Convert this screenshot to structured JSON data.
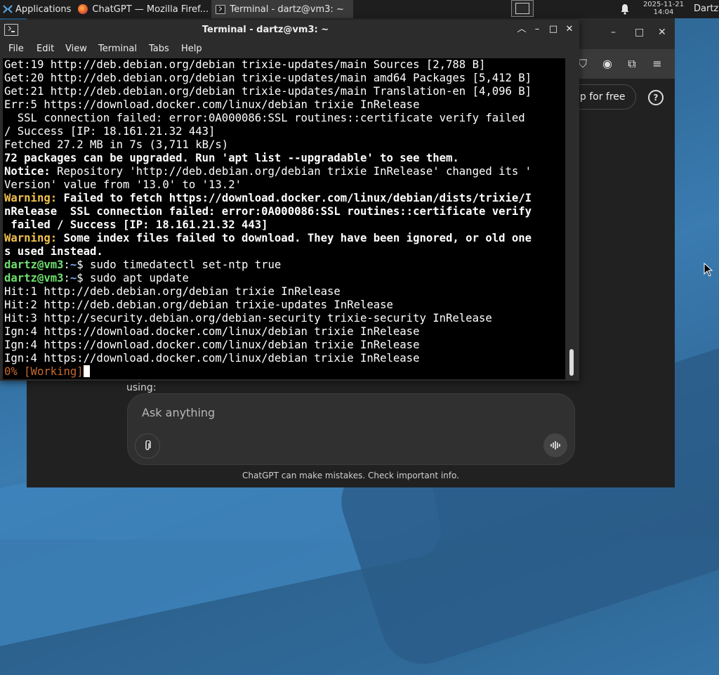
{
  "panel": {
    "apps_label": "Applications",
    "tasks": [
      {
        "label": "ChatGPT — Mozilla Firef..."
      },
      {
        "label": "Terminal - dartz@vm3: ~"
      }
    ],
    "clock_date": "2025-11-21",
    "clock_time": "14:04",
    "user": "Dartz"
  },
  "firefox": {
    "signup_label": "up for free",
    "help_label": "?",
    "partial_text": "using:",
    "composer_placeholder": "Ask anything",
    "disclaimer": "ChatGPT can make mistakes. Check important info."
  },
  "terminal": {
    "title": "Terminal - dartz@vm3: ~",
    "menu": [
      "File",
      "Edit",
      "View",
      "Terminal",
      "Tabs",
      "Help"
    ],
    "lines": [
      [
        {
          "t": "Get:19 http://deb.debian.org/debian trixie-updates/main Sources [2,788 B]"
        }
      ],
      [
        {
          "t": "Get:20 http://deb.debian.org/debian trixie-updates/main amd64 Packages [5,412 B]"
        }
      ],
      [
        {
          "t": "Get:21 http://deb.debian.org/debian trixie-updates/main Translation-en [4,096 B]"
        }
      ],
      [
        {
          "t": "Err:5 https://download.docker.com/linux/debian trixie InRelease"
        }
      ],
      [
        {
          "t": "  SSL connection failed: error:0A000086:SSL routines::certificate verify failed"
        }
      ],
      [
        {
          "t": "/ Success [IP: 18.161.21.32 443]"
        }
      ],
      [
        {
          "t": "Fetched 27.2 MB in 7s (3,711 kB/s)"
        }
      ],
      [
        {
          "t": "72 packages can be upgraded. Run 'apt list --upgradable' to see them.",
          "c": "bold"
        }
      ],
      [
        {
          "t": "Notice:",
          "c": "bold"
        },
        {
          "t": " Repository 'http://deb.debian.org/debian trixie InRelease' changed its '"
        }
      ],
      [
        {
          "t": "Version' value from '13.0' to '13.2'"
        }
      ],
      [
        {
          "t": "Warning:",
          "c": "yellow"
        },
        {
          "t": " Failed to fetch https://download.docker.com/linux/debian/dists/trixie/I",
          "c": "bold"
        }
      ],
      [
        {
          "t": "nRelease  SSL connection failed: error:0A000086:SSL routines::certificate verify",
          "c": "bold"
        }
      ],
      [
        {
          "t": " failed / Success [IP: 18.161.21.32 443]",
          "c": "bold"
        }
      ],
      [
        {
          "t": "Warning:",
          "c": "yellow"
        },
        {
          "t": " Some index files failed to download. They have been ignored, or old one",
          "c": "bold"
        }
      ],
      [
        {
          "t": "s used instead.",
          "c": "bold"
        }
      ],
      [
        {
          "t": "dartz@vm3",
          "c": "green"
        },
        {
          "t": ":"
        },
        {
          "t": "~",
          "c": "blue"
        },
        {
          "t": "$ sudo timedatectl set-ntp true"
        }
      ],
      [
        {
          "t": "dartz@vm3",
          "c": "green"
        },
        {
          "t": ":"
        },
        {
          "t": "~",
          "c": "blue"
        },
        {
          "t": "$ sudo apt update"
        }
      ],
      [
        {
          "t": "Hit:1 http://deb.debian.org/debian trixie InRelease"
        }
      ],
      [
        {
          "t": "Hit:2 http://deb.debian.org/debian trixie-updates InRelease"
        }
      ],
      [
        {
          "t": "Hit:3 http://security.debian.org/debian-security trixie-security InRelease"
        }
      ],
      [
        {
          "t": "Ign:4 https://download.docker.com/linux/debian trixie InRelease"
        }
      ],
      [
        {
          "t": "Ign:4 https://download.docker.com/linux/debian trixie InRelease"
        }
      ],
      [
        {
          "t": "Ign:4 https://download.docker.com/linux/debian trixie InRelease"
        }
      ],
      [
        {
          "t": "0% [Working]",
          "c": "dim"
        },
        {
          "cursor": true
        }
      ]
    ],
    "colors": {
      "prompt_user": "#6fe06f",
      "prompt_path": "#7ea7e8",
      "warning": "#f2c14e",
      "progress": "#c86a2e"
    }
  }
}
